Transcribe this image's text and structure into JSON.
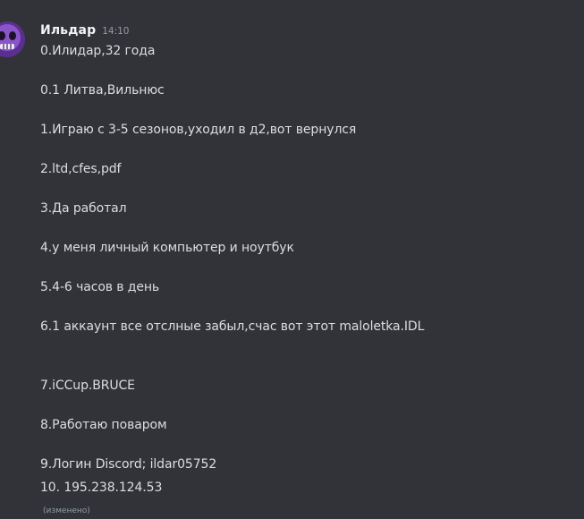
{
  "message": {
    "author": "Ильдар",
    "timestamp": "14:10",
    "lines": [
      "0.Илидар,32 года",
      "0.1 Литва,Вильнюс",
      "1.Играю с 3-5 сезонов,уходил в д2,вот вернулся",
      "2.ltd,cfes,pdf",
      "3.Да работал",
      "4.у меня личный компьютер и ноутбук",
      "5.4-6 часов в день",
      "6.1 аккаунт все отслные забыл,счас вот этот maloletka.IDL",
      "7.iCCup.BRUCE",
      "8.Работаю поваром",
      "9.Логин Discord; ildar05752",
      "10. 195.238.124.53"
    ],
    "edited_label": "(изменено)"
  },
  "colors": {
    "background": "#313338",
    "text": "#dbdee1",
    "username": "#f2f3f5",
    "muted": "#949ba4",
    "avatar": "#5b2f8f"
  },
  "icons": {
    "avatar": "purple-skull-avatar-icon"
  }
}
